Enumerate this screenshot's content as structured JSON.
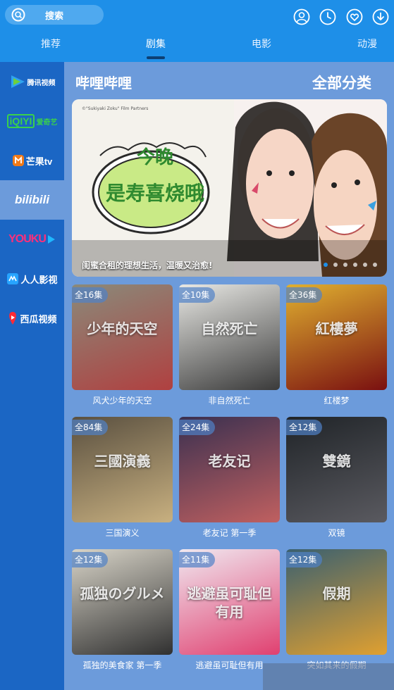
{
  "header": {
    "search_label": "搜索",
    "icons": [
      "user-icon",
      "history-icon",
      "favorite-icon",
      "download-icon"
    ]
  },
  "tabs": [
    {
      "label": "推荐",
      "active": false
    },
    {
      "label": "剧集",
      "active": true
    },
    {
      "label": "电影",
      "active": false
    },
    {
      "label": "动漫",
      "active": false
    }
  ],
  "sidebar": {
    "items": [
      {
        "name": "tencent",
        "label": "腾讯视频",
        "active": false
      },
      {
        "name": "iqiyi",
        "label": "爱奇艺",
        "active": false
      },
      {
        "name": "mango",
        "label": "芒果tv",
        "active": false
      },
      {
        "name": "bilibili",
        "label": "bilibili",
        "active": true
      },
      {
        "name": "youku",
        "label": "YOUKU",
        "active": false
      },
      {
        "name": "renren",
        "label": "人人影视",
        "active": false
      },
      {
        "name": "xigua",
        "label": "西瓜视频",
        "active": false
      }
    ]
  },
  "main": {
    "section_title": "哔哩哔哩",
    "all_categories": "全部分类",
    "banner": {
      "caption": "闺蜜合租的理想生活，温暖又治愈!",
      "credit": "©\"Sukiyaki Zoku\" Film Partners",
      "poster_text_1": "今晚",
      "poster_text_2": "是寿喜烧哦",
      "page_count": 6,
      "active_page": 1
    },
    "shows": [
      {
        "badge": "全16集",
        "title": "风犬少年的天空",
        "colors": [
          "#8a8a7a",
          "#b04040"
        ],
        "art": "少年的天空"
      },
      {
        "badge": "全10集",
        "title": "非自然死亡",
        "colors": [
          "#e8e8e4",
          "#3a3a3a"
        ],
        "art": "自然死亡"
      },
      {
        "badge": "全36集",
        "title": "红楼梦",
        "colors": [
          "#e0b030",
          "#7a1010"
        ],
        "art": "紅樓夢"
      },
      {
        "badge": "全84集",
        "title": "三国演义",
        "colors": [
          "#5a5040",
          "#c8b080"
        ],
        "art": "三國演義"
      },
      {
        "badge": "全24集",
        "title": "老友记 第一季",
        "colors": [
          "#3a3050",
          "#c06060"
        ],
        "art": "老友记"
      },
      {
        "badge": "全12集",
        "title": "双镜",
        "colors": [
          "#202428",
          "#5a5a60"
        ],
        "art": "雙鏡"
      },
      {
        "badge": "全12集",
        "title": "孤独的美食家 第一季",
        "colors": [
          "#d8d4c8",
          "#303030"
        ],
        "art": "孤独のグルメ"
      },
      {
        "badge": "全11集",
        "title": "逃避虽可耻但有用",
        "colors": [
          "#f0e8f0",
          "#e04070"
        ],
        "art": "逃避虽可耻但有用"
      },
      {
        "badge": "全12集",
        "title": "突如其来的假期",
        "colors": [
          "#3a6070",
          "#e0a030"
        ],
        "art": "假期"
      }
    ]
  },
  "colors": {
    "header_bg": "#1e8fe8",
    "sidebar_bg": "#1b66c4",
    "main_bg": "#6c9bdb",
    "tab_indicator": "#0d3f73"
  }
}
